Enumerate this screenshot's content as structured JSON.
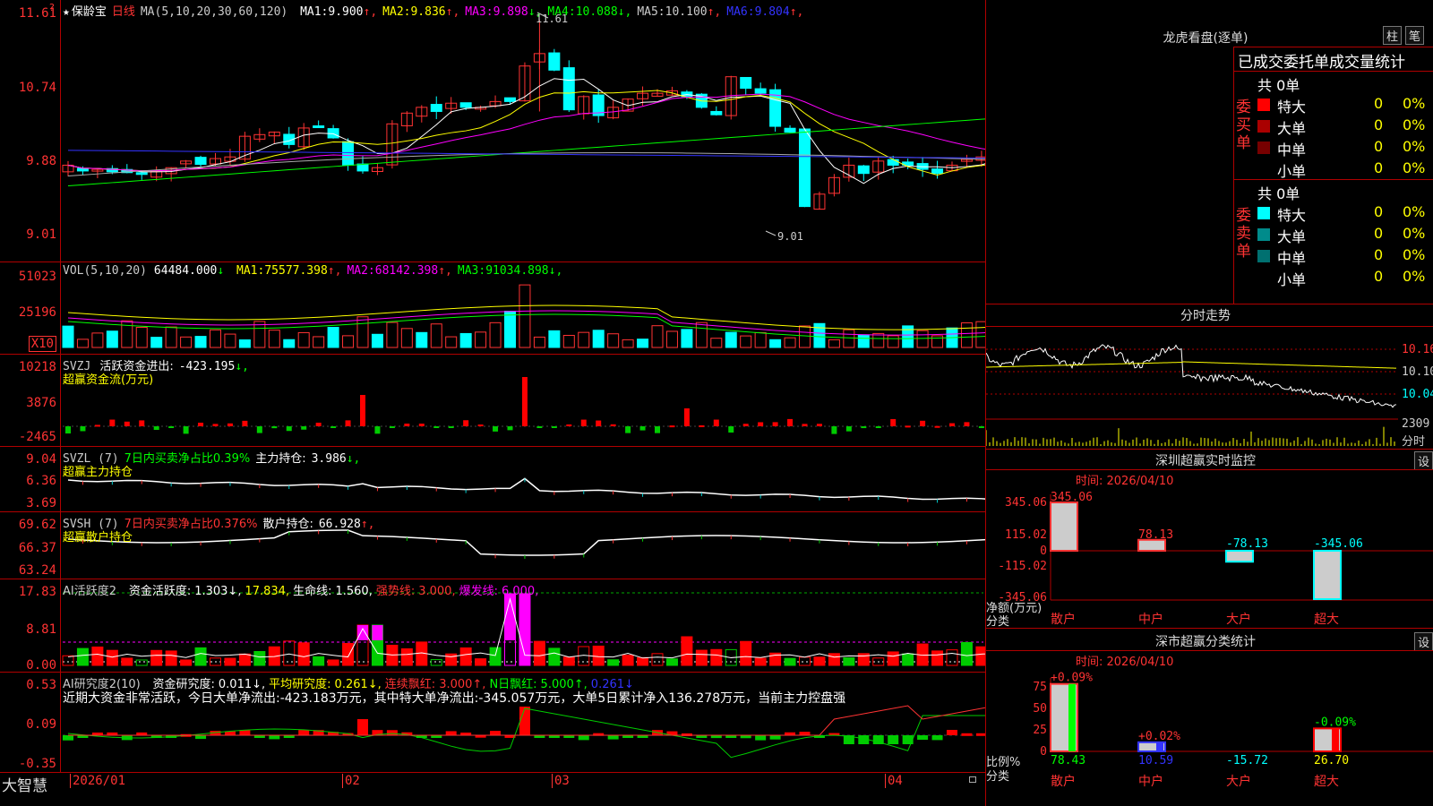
{
  "kline": {
    "star": "★",
    "name": "保龄宝",
    "period": "日线",
    "ma_label": "MA(5,10,20,30,60,120)",
    "ma": [
      {
        "label": "MA1:",
        "val": "9.900",
        "arr": "↑",
        "color": "#ffffff"
      },
      {
        "label": "MA2:",
        "val": "9.836",
        "arr": "↑",
        "color": "#ffff00"
      },
      {
        "label": "MA3:",
        "val": "9.898",
        "arr": "↓",
        "color": "#ff00ff"
      },
      {
        "label": "MA4:",
        "val": "10.088",
        "arr": "↓",
        "color": "#00ff00"
      },
      {
        "label": "MA5:",
        "val": "10.100",
        "arr": "↑",
        "color": "#cccccc"
      },
      {
        "label": "MA6:",
        "val": "9.804",
        "arr": "↑",
        "color": "#3333ff"
      }
    ],
    "axis": [
      "11.61",
      "10.74",
      "9.88",
      "9.01"
    ],
    "high_label": "11.61",
    "low_label": "9.01"
  },
  "vol": {
    "title": "VOL(5,10,20)",
    "val": "64484.000",
    "arr": "↓",
    "ma": [
      {
        "label": "MA1:",
        "val": "75577.398",
        "arr": "↑",
        "color": "#ffff00"
      },
      {
        "label": "MA2:",
        "val": "68142.398",
        "arr": "↑",
        "color": "#ff00ff"
      },
      {
        "label": "MA3:",
        "val": "91034.898",
        "arr": "↓",
        "color": "#00ff00"
      }
    ],
    "axis": [
      "51023",
      "25196"
    ],
    "unit": "X10"
  },
  "svzj": {
    "title": "SVZJ",
    "label": "活跃资金进出:",
    "val": "-423.195",
    "arr": "↓,",
    "sub": "超赢资金流(万元)",
    "axis": [
      "10218",
      "3876",
      "-2465"
    ]
  },
  "svzl": {
    "title": "SVZL (7)",
    "pct": "7日内买卖净占比0.39%",
    "label": "主力持仓:",
    "val": "3.986",
    "arr": "↓,",
    "sub": "超赢主力持仓",
    "axis": [
      "9.04",
      "6.36",
      "3.69"
    ]
  },
  "svsh": {
    "title": "SVSH (7)",
    "pct": "7日内买卖净占比0.376%",
    "label": "散户持仓:",
    "val": "66.928",
    "arr": "↑,",
    "sub": "超赢散户持仓",
    "axis": [
      "69.62",
      "66.37",
      "63.24"
    ]
  },
  "ai1": {
    "title": "AI活跃度2",
    "items": [
      {
        "t": "资金活跃度:",
        "c": "#ffffff"
      },
      {
        "t": "1.303↓,",
        "c": "#ffffff"
      },
      {
        "t": "17.834,",
        "c": "#ffff00"
      },
      {
        "t": "生命线:",
        "c": "#ffffff"
      },
      {
        "t": "1.560,",
        "c": "#ffffff"
      },
      {
        "t": "强势线:",
        "c": "#ff3333"
      },
      {
        "t": "3.000,",
        "c": "#ff3333"
      },
      {
        "t": "爆发线:",
        "c": "#ff00ff"
      },
      {
        "t": "6.000,",
        "c": "#ff00ff"
      }
    ],
    "axis": [
      "17.83",
      "8.81",
      "0.00"
    ]
  },
  "ai2": {
    "title": "AI研究度2(10)",
    "items": [
      {
        "t": "资金研究度:",
        "c": "#ffffff"
      },
      {
        "t": "0.011↓,",
        "c": "#ffffff"
      },
      {
        "t": "平均研究度:",
        "c": "#ffff00"
      },
      {
        "t": "0.261↓,",
        "c": "#ffff00"
      },
      {
        "t": "连续飘红:",
        "c": "#ff3333"
      },
      {
        "t": "3.000↑,",
        "c": "#ff3333"
      },
      {
        "t": "N日飘红:",
        "c": "#00ff00"
      },
      {
        "t": "5.000↑,",
        "c": "#00ff00"
      },
      {
        "t": "0.261↓",
        "c": "#3333ff"
      }
    ],
    "note": "近期大资金非常活跃，今日大单净流出:-423.183万元，其中特大单净流出:-345.057万元，大单5日累计净入136.278万元，当前主力控盘强",
    "axis": [
      "0.53",
      "0.09",
      "-0.35"
    ]
  },
  "dates": [
    "2026/01",
    "02",
    "03",
    "04"
  ],
  "brand": "大智慧",
  "dragon": {
    "title": "龙虎看盘(逐单)",
    "btn1": "柱",
    "btn2": "笔",
    "head": "已成交委托单成交量统计",
    "buy": {
      "side": "委买单",
      "total": "共 0单",
      "rows": [
        {
          "name": "特大",
          "color": "#ff0000",
          "v": "0",
          "p": "0%"
        },
        {
          "name": "大单",
          "color": "#aa0000",
          "v": "0",
          "p": "0%"
        },
        {
          "name": "中单",
          "color": "#770000",
          "v": "0",
          "p": "0%"
        },
        {
          "name": "小单",
          "color": "#000000",
          "v": "0",
          "p": "0%"
        }
      ]
    },
    "sell": {
      "side": "委卖单",
      "total": "共 0单",
      "rows": [
        {
          "name": "特大",
          "color": "#00ffff",
          "v": "0",
          "p": "0%"
        },
        {
          "name": "大单",
          "color": "#008b8b",
          "v": "0",
          "p": "0%"
        },
        {
          "name": "中单",
          "color": "#007070",
          "v": "0",
          "p": "0%"
        },
        {
          "name": "小单",
          "color": "#000000",
          "v": "0",
          "p": "0%"
        }
      ]
    }
  },
  "intraday": {
    "title": "分时走势",
    "axis": [
      "10.16",
      "10.10",
      "10.04",
      "2309"
    ],
    "unit": "分时"
  },
  "sz_monitor": {
    "title": "深圳超赢实时监控",
    "btn": "设",
    "time": "时间: 2026/04/10",
    "axis": [
      "345.06",
      "115.02",
      "0",
      "-115.02",
      "-345.06"
    ],
    "ylabel": "净额(万元)",
    "xlabel": "分类",
    "bars": [
      {
        "cat": "散户",
        "val": "345.06",
        "v": 345.06
      },
      {
        "cat": "中户",
        "val": "78.13",
        "v": 78.13
      },
      {
        "cat": "大户",
        "val": "-78.13",
        "v": -78.13
      },
      {
        "cat": "超大",
        "val": "-345.06",
        "v": -345.06
      }
    ]
  },
  "sz_class": {
    "title": "深市超赢分类统计",
    "btn": "设",
    "time": "时间: 2026/04/10",
    "axis": [
      "75",
      "50",
      "25",
      "0"
    ],
    "ylabel": "比例%",
    "xlabel": "分类",
    "bars": [
      {
        "cat": "散户",
        "top": "+0.09%",
        "bottom": "78.43",
        "v": 78.43
      },
      {
        "cat": "中户",
        "top": "+0.02%",
        "bottom": "10.59",
        "v": 10.59
      },
      {
        "cat": "大户",
        "top": "",
        "bottom": "-15.72",
        "v": -15.72
      },
      {
        "cat": "超大",
        "top": "-0.09%",
        "bottom": "26.70",
        "v": 26.7
      }
    ]
  }
}
